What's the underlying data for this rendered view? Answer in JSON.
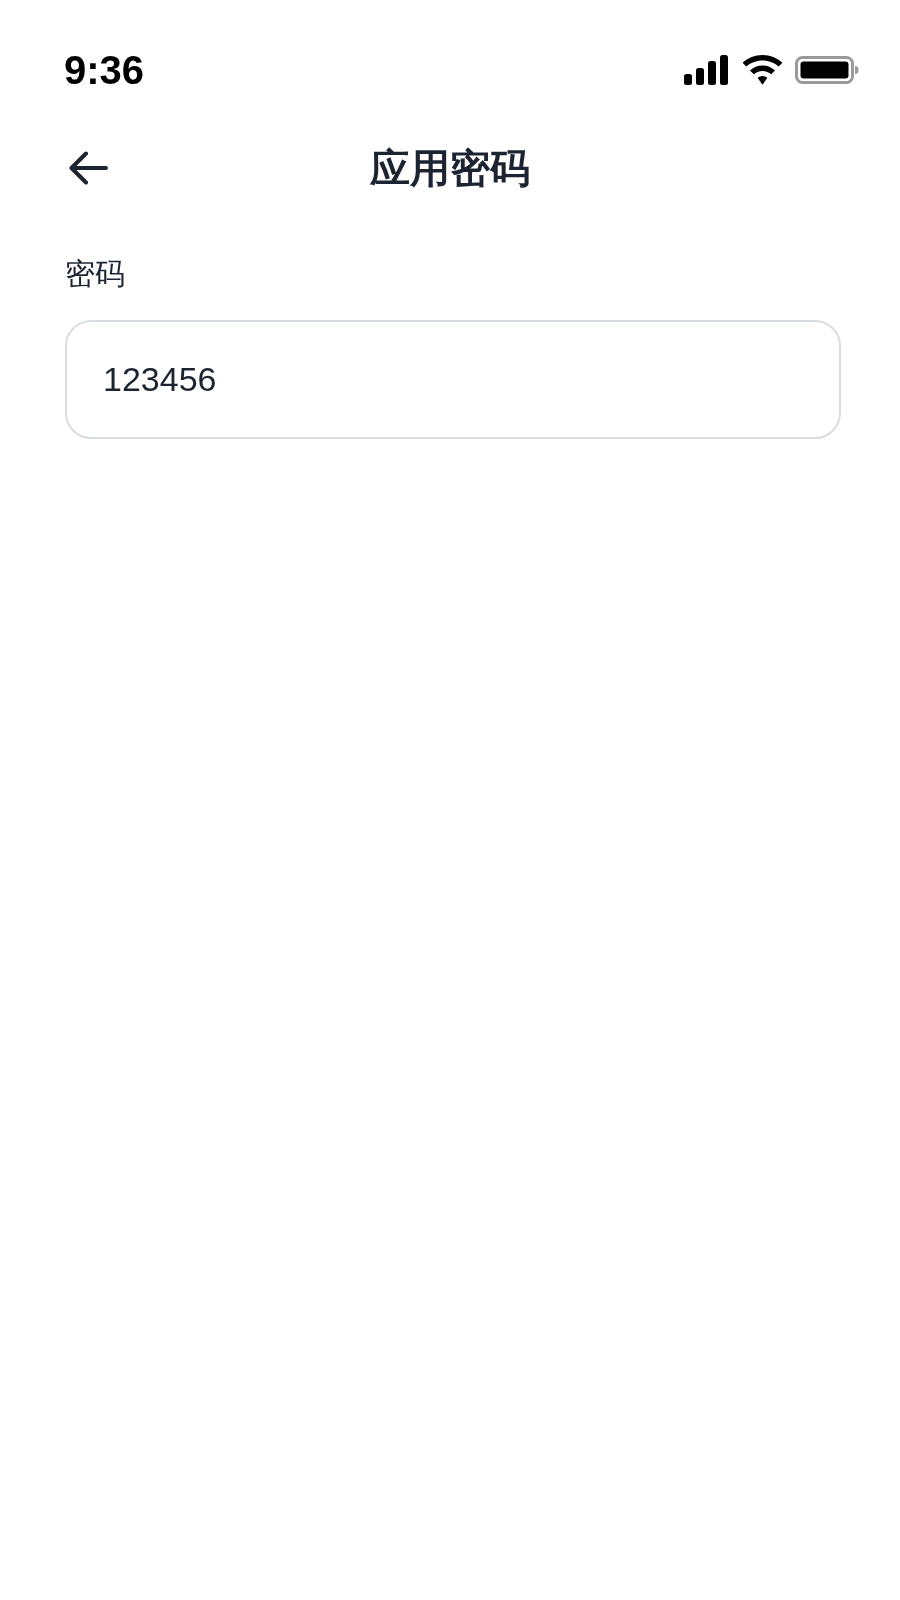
{
  "status_bar": {
    "time": "9:36"
  },
  "header": {
    "title": "应用密码"
  },
  "form": {
    "fields": [
      {
        "label": "密码",
        "value": "123456"
      }
    ]
  }
}
